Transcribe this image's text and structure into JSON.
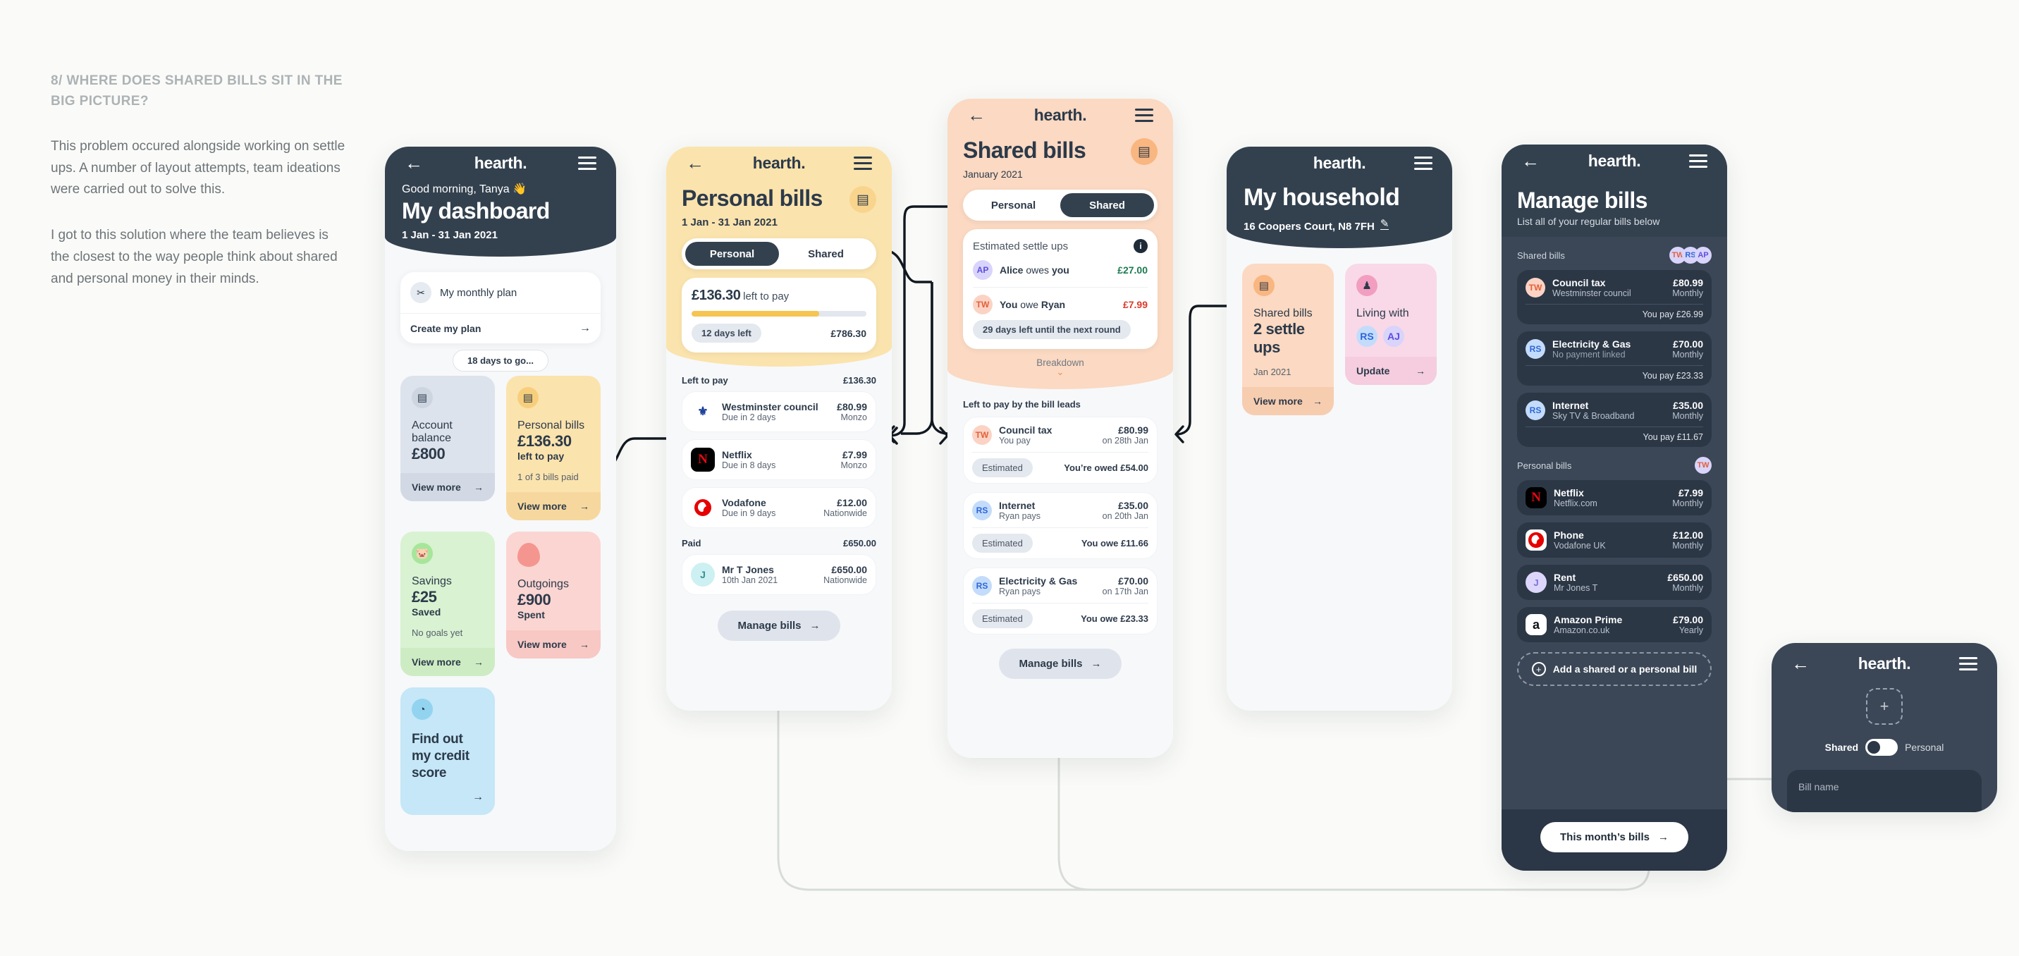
{
  "note": {
    "heading": "8/ WHERE DOES SHARED BILLS SIT IN THE BIG PICTURE?",
    "p1": "This problem occured alongside working on settle ups. A number of layout attempts, team ideations were carried out to solve this.",
    "p2": "I got to this solution where the team believes is the closest to the way people think about shared and personal money in their minds."
  },
  "brand": "hearth.",
  "dashboard": {
    "greeting": "Good morning, Tanya 👋",
    "title": "My dashboard",
    "daterange": "1 Jan - 31 Jan 2021",
    "plan_card": {
      "label": "My monthly plan",
      "cta": "Create my plan"
    },
    "days_chip": "18 days to go...",
    "cards": [
      {
        "icon": "wallet-icon",
        "label": "Account balance",
        "amount": "£800",
        "sub": "",
        "note": "",
        "cta": "View more"
      },
      {
        "icon": "bill-icon",
        "label": "Personal bills",
        "amount": "£136.30",
        "sub": "left to pay",
        "note": "1 of 3 bills paid",
        "cta": "View more"
      },
      {
        "icon": "piggy-icon",
        "label": "Savings",
        "amount": "£25",
        "sub": "Saved",
        "note": "No goals yet",
        "cta": "View more"
      },
      {
        "icon": "drop-icon",
        "label": "Outgoings",
        "amount": "£900",
        "sub": "Spent",
        "note": "",
        "cta": "View more"
      }
    ],
    "credit_card": {
      "title": "Find out my credit score"
    }
  },
  "personal": {
    "title": "Personal bills",
    "daterange": "1 Jan - 31 Jan 2021",
    "tabs": [
      "Personal",
      "Shared"
    ],
    "active_tab": "Personal",
    "summary": {
      "amount": "£136.30",
      "suffix": "left to pay",
      "days": "12 days left",
      "total": "£786.30",
      "progress_pct": 73
    },
    "left_label": "Left to pay",
    "left_total": "£136.30",
    "left_items": [
      {
        "logo": "westminster-council-icon",
        "name": "Westminster council",
        "due": "Due in 2 days",
        "amount": "£80.99",
        "bank": "Monzo"
      },
      {
        "logo": "netflix-icon",
        "name": "Netflix",
        "due": "Due in 8 days",
        "amount": "£7.99",
        "bank": "Monzo"
      },
      {
        "logo": "vodafone-icon",
        "name": "Vodafone",
        "due": "Due in 9 days",
        "amount": "£12.00",
        "bank": "Nationwide"
      }
    ],
    "paid_label": "Paid",
    "paid_total": "£650.00",
    "paid_items": [
      {
        "logo": "initial-j-icon",
        "name": "Mr T Jones",
        "due": "10th Jan 2021",
        "amount": "£650.00",
        "bank": "Nationwide"
      }
    ],
    "manage_cta": "Manage bills"
  },
  "shared": {
    "title": "Shared bills",
    "daterange": "January 2021",
    "tabs": [
      "Personal",
      "Shared"
    ],
    "active_tab": "Shared",
    "settle_title": "Estimated settle ups",
    "settle_rows": [
      {
        "initials": "AP",
        "pre": "Alice",
        "mid": " owes ",
        "post": "you",
        "amount": "£27.00",
        "tone": "credit"
      },
      {
        "initials": "TW",
        "pre": "You",
        "mid": " owe ",
        "post": "Ryan",
        "amount": "£7.99",
        "tone": "debit"
      }
    ],
    "round_chip": "29 days left until the next round",
    "breakdown": "Breakdown",
    "leads_label": "Left to pay by the bill leads",
    "leads": [
      {
        "initials": "TW",
        "name": "Council tax",
        "payer": "You pay",
        "amount": "£80.99",
        "when": "on 28th Jan",
        "tag": "Estimated",
        "balance": "You’re owed £54.00"
      },
      {
        "initials": "RS",
        "name": "Internet",
        "payer": "Ryan pays",
        "amount": "£35.00",
        "when": "on 20th Jan",
        "tag": "Estimated",
        "balance": "You owe £11.66"
      },
      {
        "initials": "RS",
        "name": "Electricity & Gas",
        "payer": "Ryan pays",
        "amount": "£70.00",
        "when": "on 17th Jan",
        "tag": "Estimated",
        "balance": "You owe £23.33"
      }
    ],
    "manage_cta": "Manage bills"
  },
  "household": {
    "title": "My household",
    "address": "16 Coopers Court, N8 7FH",
    "cards": [
      {
        "icon": "bill-icon",
        "label": "Shared bills",
        "value": "2 settle ups",
        "note": "Jan 2021",
        "cta": "View more"
      },
      {
        "icon": "people-icon",
        "label": "Living with",
        "avatars": [
          "RS",
          "AJ"
        ],
        "cta": "Update"
      }
    ]
  },
  "manage": {
    "title": "Manage bills",
    "subtitle": "List all of your regular bills below",
    "shared_label": "Shared bills",
    "shared_avatars": [
      "TW",
      "RS",
      "AP"
    ],
    "shared_bills": [
      {
        "initials": "TW",
        "name": "Council tax",
        "provider": "Westminster council",
        "amount": "£80.99",
        "freq": "Monthly",
        "split": "You pay £26.99"
      },
      {
        "initials": "RS",
        "name": "Electricity & Gas",
        "provider": "No payment linked",
        "amount": "£70.00",
        "freq": "Monthly",
        "split": "You pay £23.33"
      },
      {
        "initials": "RS",
        "name": "Internet",
        "provider": "Sky TV & Broadband",
        "amount": "£35.00",
        "freq": "Monthly",
        "split": "You pay £11.67"
      }
    ],
    "personal_label": "Personal bills",
    "personal_avatars": [
      "TW"
    ],
    "personal_bills": [
      {
        "logo": "netflix-icon",
        "name": "Netflix",
        "provider": "Netflix.com",
        "amount": "£7.99",
        "freq": "Monthly"
      },
      {
        "logo": "vodafone-icon",
        "name": "Phone",
        "provider": "Vodafone UK",
        "amount": "£12.00",
        "freq": "Monthly"
      },
      {
        "logo": "initial-j-icon",
        "name": "Rent",
        "provider": "Mr Jones T",
        "amount": "£650.00",
        "freq": "Monthly"
      },
      {
        "logo": "amazon-icon",
        "name": "Amazon Prime",
        "provider": "Amazon.co.uk",
        "amount": "£79.00",
        "freq": "Yearly"
      }
    ],
    "add_cta": "Add a shared or a personal bill",
    "month_cta": "This month’s bills"
  },
  "addbill": {
    "toggle_left": "Shared",
    "toggle_right": "Personal",
    "field_placeholder": "Bill name"
  },
  "colors": {
    "navy": "#33414f",
    "yellow": "#fbe3ad",
    "peach": "#fbd9c2",
    "green": "#d5f0cd",
    "pink": "#fbd5d2",
    "blue": "#c5e7f7",
    "credit": "#1c7a52",
    "debit": "#d93b2b"
  }
}
